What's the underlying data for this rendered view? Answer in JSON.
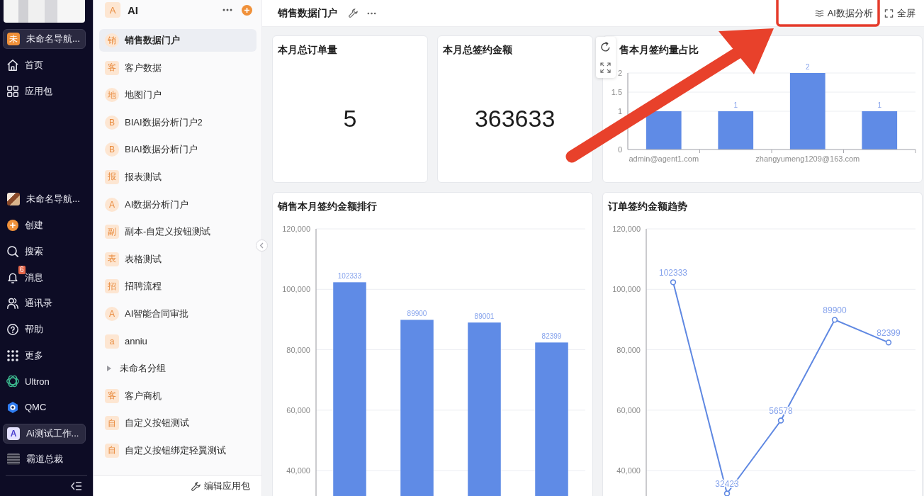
{
  "nav": {
    "top_items": [
      {
        "label": "未命名导航...",
        "badge": "未",
        "selected": true
      },
      {
        "label": "首页",
        "selected": false
      },
      {
        "label": "应用包",
        "selected": false
      }
    ],
    "bottom_items": [
      {
        "label": "未命名导航...",
        "selected": false
      },
      {
        "label": "创建",
        "selected": false
      },
      {
        "label": "搜索",
        "selected": false
      },
      {
        "label": "消息",
        "count": "6",
        "selected": false
      },
      {
        "label": "通讯录",
        "selected": false
      },
      {
        "label": "帮助",
        "selected": false
      },
      {
        "label": "更多",
        "selected": false
      },
      {
        "label": "Ultron",
        "selected": false
      },
      {
        "label": "QMC",
        "selected": false
      },
      {
        "label": "Ai测试工作...",
        "badge": "A",
        "selected": true
      },
      {
        "label": "霸道总裁",
        "selected": false
      }
    ]
  },
  "app_panel": {
    "badge": "A",
    "title": "AI",
    "items": [
      {
        "kind": "portal",
        "badge": "销",
        "label": "销售数据门户",
        "selected": true
      },
      {
        "kind": "form",
        "badge": "客",
        "label": "客户数据",
        "selected": false
      },
      {
        "kind": "portal",
        "badge": "地",
        "label": "地图门户",
        "selected": false
      },
      {
        "kind": "portal",
        "badge": "B",
        "label": "BIAI数据分析门户2",
        "selected": false
      },
      {
        "kind": "portal",
        "badge": "B",
        "label": "BIAI数据分析门户",
        "selected": false
      },
      {
        "kind": "form",
        "badge": "报",
        "label": "报表测试",
        "selected": false
      },
      {
        "kind": "portal",
        "badge": "A",
        "label": "AI数据分析门户",
        "selected": false
      },
      {
        "kind": "form",
        "badge": "副",
        "label": "副本-自定义按钮测试",
        "selected": false
      },
      {
        "kind": "form",
        "badge": "表",
        "label": "表格测试",
        "selected": false
      },
      {
        "kind": "form",
        "badge": "招",
        "label": "招聘流程",
        "selected": false
      },
      {
        "kind": "portal",
        "badge": "A",
        "label": "AI智能合同审批",
        "selected": false
      },
      {
        "kind": "form",
        "badge": "a",
        "label": "anniu",
        "selected": false
      },
      {
        "kind": "group",
        "label": "未命名分组",
        "expanded": false,
        "selected": false
      },
      {
        "kind": "form",
        "badge": "客",
        "label": "客户商机",
        "selected": false
      },
      {
        "kind": "form",
        "badge": "自",
        "label": "自定义按钮测试",
        "selected": false
      },
      {
        "kind": "form",
        "badge": "自",
        "label": "自定义按钮绑定轻翼测试",
        "selected": false
      }
    ],
    "footer_button": "编辑应用包"
  },
  "header": {
    "title": "销售数据门户",
    "ai_button": "AI数据分析",
    "fullscreen_button": "全屏"
  },
  "kpi_cards": [
    {
      "title": "本月总订单量",
      "value": "5"
    },
    {
      "title": "本月总签约金额",
      "value": "363633"
    }
  ],
  "charts": [
    {
      "title": "售本月签约量占比",
      "toolbar": true,
      "chart_data": {
        "type": "bar",
        "categories": [
          "admin@agent1.com",
          null,
          "zhangyumeng1209@163.com",
          null
        ],
        "values": [
          1,
          1,
          2,
          1
        ],
        "ylim": [
          0,
          2
        ],
        "yticks": [
          0,
          1,
          1.5,
          2
        ],
        "grid": true,
        "value_labels": [
          null,
          "1",
          "2",
          "1"
        ]
      }
    },
    {
      "title": "销售本月签约金额排行",
      "toolbar": false,
      "chart_data": {
        "type": "bar",
        "values": [
          102333,
          89900,
          89001,
          82399
        ],
        "ylim": [
          31600,
          120000
        ],
        "yticks": [
          {
            "value": 40000,
            "label": "40,000"
          },
          {
            "value": 60000,
            "label": "60,000"
          },
          {
            "value": 80000,
            "label": "80,000"
          },
          {
            "value": 100000,
            "label": "100,000"
          },
          {
            "value": 120000,
            "label": "120,000"
          }
        ],
        "grid": true,
        "value_labels": [
          "102333",
          "89900",
          "89001",
          "82399"
        ]
      }
    },
    {
      "title": "订单签约金额趋势",
      "toolbar": false,
      "chart_data": {
        "type": "line",
        "values": [
          102333,
          32423,
          56578,
          89900,
          82399
        ],
        "ylim": [
          31600,
          120000
        ],
        "yticks": [
          {
            "value": 40000,
            "label": "40,000"
          },
          {
            "value": 60000,
            "label": "60,000"
          },
          {
            "value": 80000,
            "label": "80,000"
          },
          {
            "value": 100000,
            "label": "100,000"
          },
          {
            "value": 120000,
            "label": "120,000"
          }
        ],
        "grid": true,
        "marker": true,
        "value_labels": [
          "102333",
          "32423",
          "56578",
          "89900",
          "82399"
        ]
      }
    }
  ]
}
